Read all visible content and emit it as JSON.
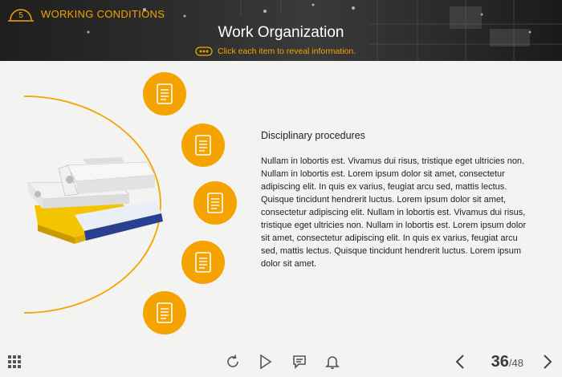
{
  "header": {
    "section_number": "5",
    "section_title": "WORKING CONDITIONS",
    "page_title": "Work Organization",
    "instruction": "Click each item to reveal information."
  },
  "items": [
    {
      "icon": "document-icon"
    },
    {
      "icon": "document-icon"
    },
    {
      "icon": "document-icon"
    },
    {
      "icon": "document-icon"
    },
    {
      "icon": "document-icon"
    }
  ],
  "info": {
    "title": "Disciplinary procedures",
    "body": "Nullam in lobortis est. Vivamus dui risus, tristique eget ultricies non. Nullam in lobortis est. Lorem ipsum dolor sit amet, consectetur adipiscing elit. In quis ex varius, feugiat arcu sed, mattis lectus. Quisque tincidunt hendrerit luctus. Lorem ipsum dolor sit amet, consectetur adipiscing elit. Nullam in lobortis est. Vivamus dui risus, tristique eget ultricies non. Nullam in lobortis est. Lorem ipsum dolor sit amet, consectetur adipiscing elit. In quis ex varius, feugiat arcu sed, mattis lectus. Quisque tincidunt hendrerit luctus. Lorem ipsum dolor sit amet."
  },
  "footer": {
    "current_page": "36",
    "total_pages": "/48"
  },
  "colors": {
    "accent": "#f5a300",
    "header_bg": "#2a2a2a",
    "content_bg": "#f3f3f1"
  }
}
